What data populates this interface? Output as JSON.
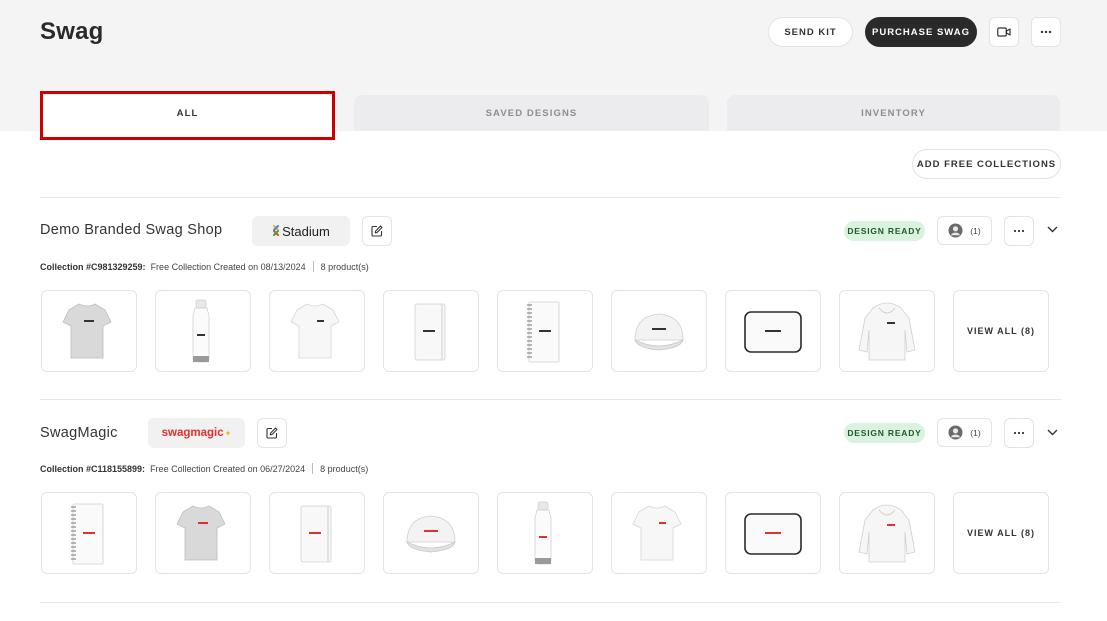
{
  "header": {
    "title": "Swag",
    "send_kit": "SEND KIT",
    "purchase_swag": "PURCHASE SWAG",
    "video_icon": "video-camera-icon",
    "more_icon": "more-dots-icon"
  },
  "tabs": [
    {
      "label": "ALL",
      "active": true
    },
    {
      "label": "SAVED DESIGNS",
      "active": false
    },
    {
      "label": "INVENTORY",
      "active": false
    }
  ],
  "add_free_collections": "ADD FREE COLLECTIONS",
  "collections": [
    {
      "name": "Demo Branded Swag Shop",
      "logo_text": "Stadium",
      "status": "DESIGN READY",
      "owners": "(1)",
      "collection_id": "Collection #C981329259:",
      "created": "Free Collection Created on 08/13/2024",
      "products_count": "8 product(s)",
      "view_all": "VIEW ALL (8)",
      "products": [
        "tshirt-gray",
        "water-bottle",
        "tshirt-white",
        "notebook",
        "spiral-notebook",
        "cap",
        "laptop-sleeve",
        "hoodie"
      ],
      "product_label": "Stadium"
    },
    {
      "name": "SwagMagic",
      "logo_text": "swagmagic",
      "status": "DESIGN READY",
      "owners": "(1)",
      "collection_id": "Collection #C118155899:",
      "created": "Free Collection Created on 06/27/2024",
      "products_count": "8 product(s)",
      "view_all": "VIEW ALL (8)",
      "products": [
        "spiral-notebook",
        "tshirt-gray",
        "notebook",
        "cap",
        "water-bottle",
        "tshirt-white",
        "laptop-sleeve",
        "hoodie"
      ],
      "product_label": "swagmagic"
    }
  ],
  "colors": {
    "accent_dark": "#2a2a2a",
    "badge_bg": "#d9f3df",
    "highlight": "#cc0000",
    "swagmagic_red": "#e0322d"
  }
}
